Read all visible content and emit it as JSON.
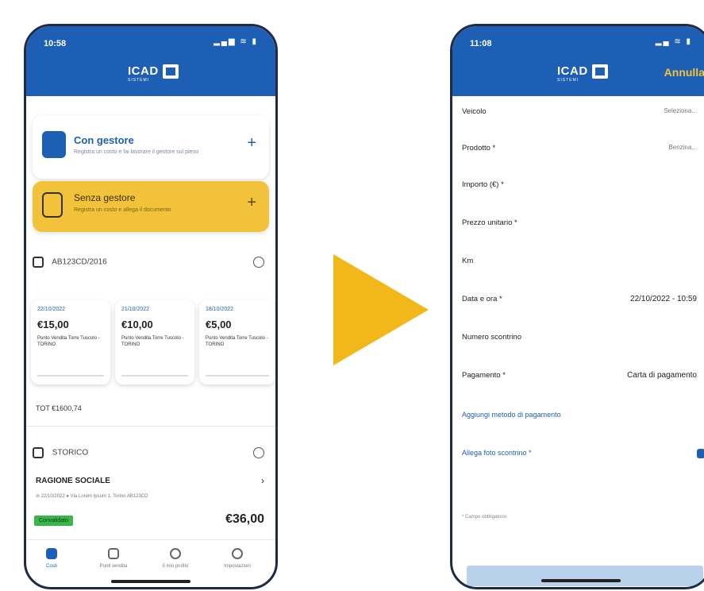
{
  "left": {
    "status_time": "10:58",
    "status_icons": "▂▄▆ ≋ ▮",
    "logo_text": "ICAD",
    "logo_sub": "SISTEMI",
    "card_con": {
      "title": "Con gestore",
      "subtitle": "Registra un costo e fai lavorare il gestore sul pieno"
    },
    "card_senza": {
      "title": "Senza gestore",
      "subtitle": "Registra un costo e allega il documento"
    },
    "plus": "+",
    "vehicle_row": "AB123CD/2016",
    "mini_cards": [
      {
        "date": "22/10/2022",
        "arrow": "+",
        "amount": "€15,00",
        "desc": "Punto Vendita Torre Tuscolo - TORINO"
      },
      {
        "date": "21/10/2022",
        "arrow": "+",
        "amount": "€10,00",
        "desc": "Punto Vendita Torre Tuscolo - TORINO"
      },
      {
        "date": "18/10/2022",
        "arrow": "",
        "amount": "€5,00",
        "desc": "Punto Vendita Torre Tuscolo - TORINO"
      }
    ],
    "total": "TOT €1600,74",
    "storico_label": "STORICO",
    "ragione": "RAGIONE SOCIALE",
    "chevron": "›",
    "details": "⊘ 22/10/2022   ● Via Lorem Ipsum 1, Torino   AB123CD",
    "badge": "Convalidato",
    "big_amount": "€36,00",
    "nav": [
      {
        "label": "Costi"
      },
      {
        "label": "Punti vendita"
      },
      {
        "label": "Il mio profilo"
      },
      {
        "label": "Impostazioni"
      }
    ]
  },
  "right": {
    "status_time": "11:08",
    "status_icons": "▂▄ ≋ ▮",
    "logo_text": "ICAD",
    "logo_sub": "SISTEMI",
    "annulla": "Annulla",
    "fields": [
      {
        "label": "Veicolo",
        "value": "Seleziona...",
        "chev": "›"
      },
      {
        "label": "Prodotto *",
        "value": "Benzina...",
        "chev": "›"
      },
      {
        "label": "Importo (€) *",
        "value": "",
        "chev": ""
      },
      {
        "label": "Prezzo unitario *",
        "value": "",
        "chev": ""
      },
      {
        "label": "Km",
        "value": "",
        "chev": ""
      },
      {
        "label": "Data e ora *",
        "value": "22/10/2022 - 10:59",
        "chev": "›"
      },
      {
        "label": "Numero scontrino",
        "value": "",
        "chev": ""
      },
      {
        "label": "Pagamento *",
        "value": "Carta di pagamento",
        "chev": "›"
      }
    ],
    "add_payment": "Aggiungi metodo di pagamento",
    "attach_receipt": "Allega foto scontrino *",
    "note": "* Campo obbligatorio"
  }
}
